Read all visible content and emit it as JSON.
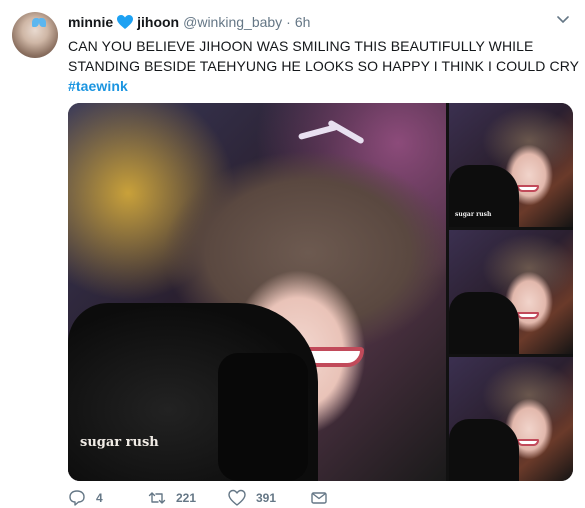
{
  "tweet": {
    "display_name": "minnie",
    "heart_icon": "blue-heart-icon",
    "display_name_suffix": "jihoon",
    "handle": "@winking_baby",
    "separator": "·",
    "time": "6h",
    "text_lines": [
      "CAN YOU BELIEVE JIHOON WAS SMILING THIS BEAUTIFULLY WHILE",
      "STANDING BESIDE TAEHYUNG HE LOOKS SO HAPPY I THINK I COULD CRY"
    ],
    "hashtag": "#taewink",
    "media": {
      "main_caption": "sugar rush",
      "thumb_captions": [
        "sugar rush",
        "",
        ""
      ]
    },
    "actions": {
      "replies": "4",
      "retweets": "221",
      "likes": "391"
    }
  },
  "colors": {
    "link": "#1b95e0",
    "heart": "#1da1f2",
    "muted": "#657786",
    "text": "#14171a"
  }
}
